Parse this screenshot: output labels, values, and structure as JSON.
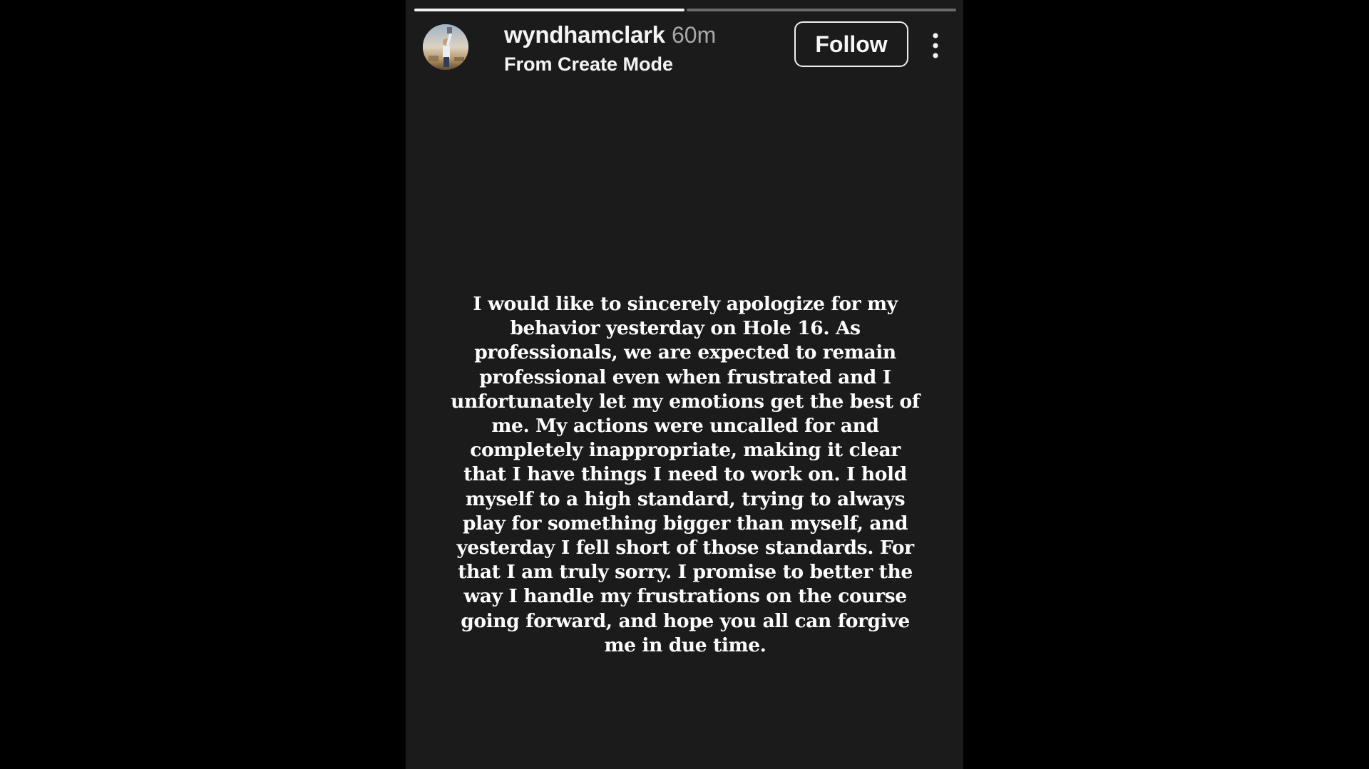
{
  "colors": {
    "page_background": "#000000",
    "story_background": "#1b1b1b",
    "text_primary": "#ffffff",
    "text_muted": "#a8a8a8"
  },
  "story": {
    "progress": {
      "segments": 2,
      "current_segment": 1,
      "fill_fraction": 1.0
    },
    "header": {
      "avatar_icon": "profile-avatar",
      "username": "wyndhamclark",
      "time_ago": "60m",
      "subtitle": "From Create Mode",
      "follow_label": "Follow",
      "more_icon": "vertical-ellipsis-icon"
    },
    "message": "I would like to sincerely apologize for my behavior yesterday on Hole 16. As professionals, we are expected to remain professional even when frustrated and I unfortunately let my emotions get the best of me. My actions were uncalled for and completely inappropriate, making it clear that I have things I need to work on. I hold myself to a high standard, trying to always play for something bigger than myself, and yesterday I fell short of those standards. For that I am truly sorry. I promise to better the way I handle my frustrations on the course going forward, and hope you all can forgive me in due time."
  }
}
